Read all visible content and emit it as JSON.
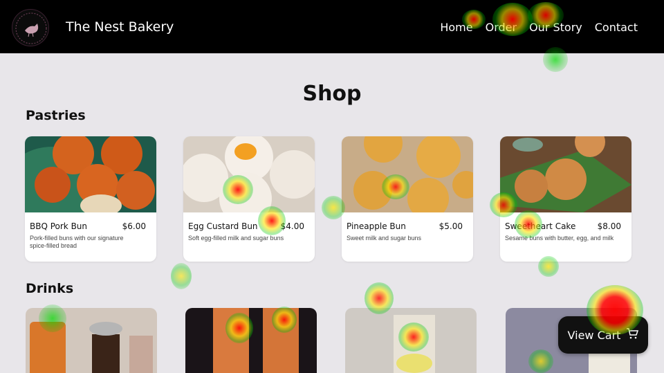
{
  "header": {
    "logo_text": "The Nest Bakery",
    "brand": "The Nest Bakery",
    "nav": [
      {
        "label": "Home"
      },
      {
        "label": "Order"
      },
      {
        "label": "Our Story"
      },
      {
        "label": "Contact"
      }
    ]
  },
  "main": {
    "title": "Shop",
    "pastries": {
      "heading": "Pastries",
      "items": [
        {
          "name": "BBQ Pork Bun",
          "price": "$6.00",
          "desc": "Pork-filled buns with our signature spice-filled bread"
        },
        {
          "name": "Egg Custard Bun",
          "price": "$4.00",
          "desc": "Soft egg-filled milk and sugar buns"
        },
        {
          "name": "Pineapple Bun",
          "price": "$5.00",
          "desc": "Sweet milk and sugar buns"
        },
        {
          "name": "Sweetheart Cake",
          "price": "$8.00",
          "desc": "Sesame buns with butter, egg, and milk"
        }
      ]
    },
    "drinks": {
      "heading": "Drinks"
    }
  },
  "cart": {
    "label": "View Cart",
    "icon": "cart-icon"
  },
  "colors": {
    "header_bg": "#000000",
    "page_bg": "#e8e6ea",
    "card_bg": "#ffffff"
  }
}
